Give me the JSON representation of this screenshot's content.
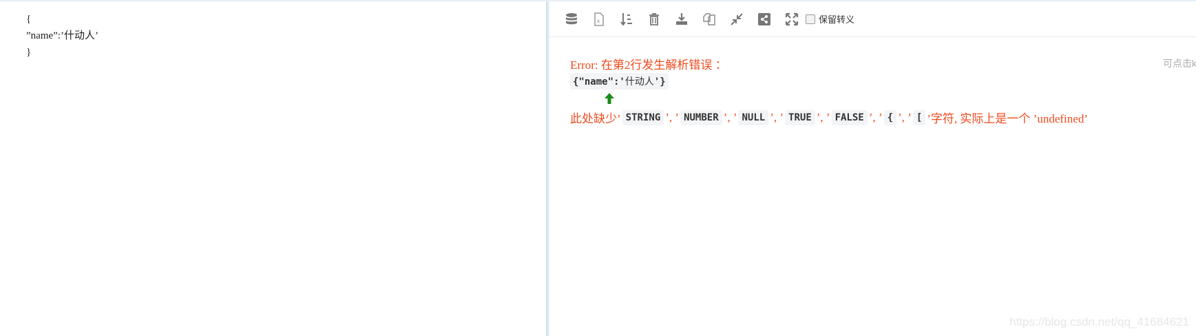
{
  "editor": {
    "lines": [
      "{",
      "”name”:’什动人’",
      "}"
    ]
  },
  "toolbar": {
    "icons": [
      "database-icon",
      "excel-icon",
      "sort-icon",
      "trash-icon",
      "download-icon",
      "copy-icon",
      "compress-icon",
      "share-icon",
      "expand-icon"
    ],
    "keep_escape_label": "保留转义"
  },
  "result": {
    "error_title": "Error: 在第2行发生解析错误 ：",
    "hint": "可点击k",
    "code_prefix": "{\"name\":'",
    "code_cn": "什动人",
    "code_suffix": "'}",
    "missing_prefix": "此处缺少’",
    "tokens": [
      "STRING",
      "NUMBER",
      "NULL",
      "TRUE",
      "FALSE",
      "{",
      "["
    ],
    "sep": "’, ’",
    "missing_suffix": "’字符, 实际上是一个 ’undefined’",
    "arrow_color": "#1a8a1a",
    "error_color": "#f04b1e"
  },
  "watermark": "https://blog.csdn.net/qq_41684621"
}
